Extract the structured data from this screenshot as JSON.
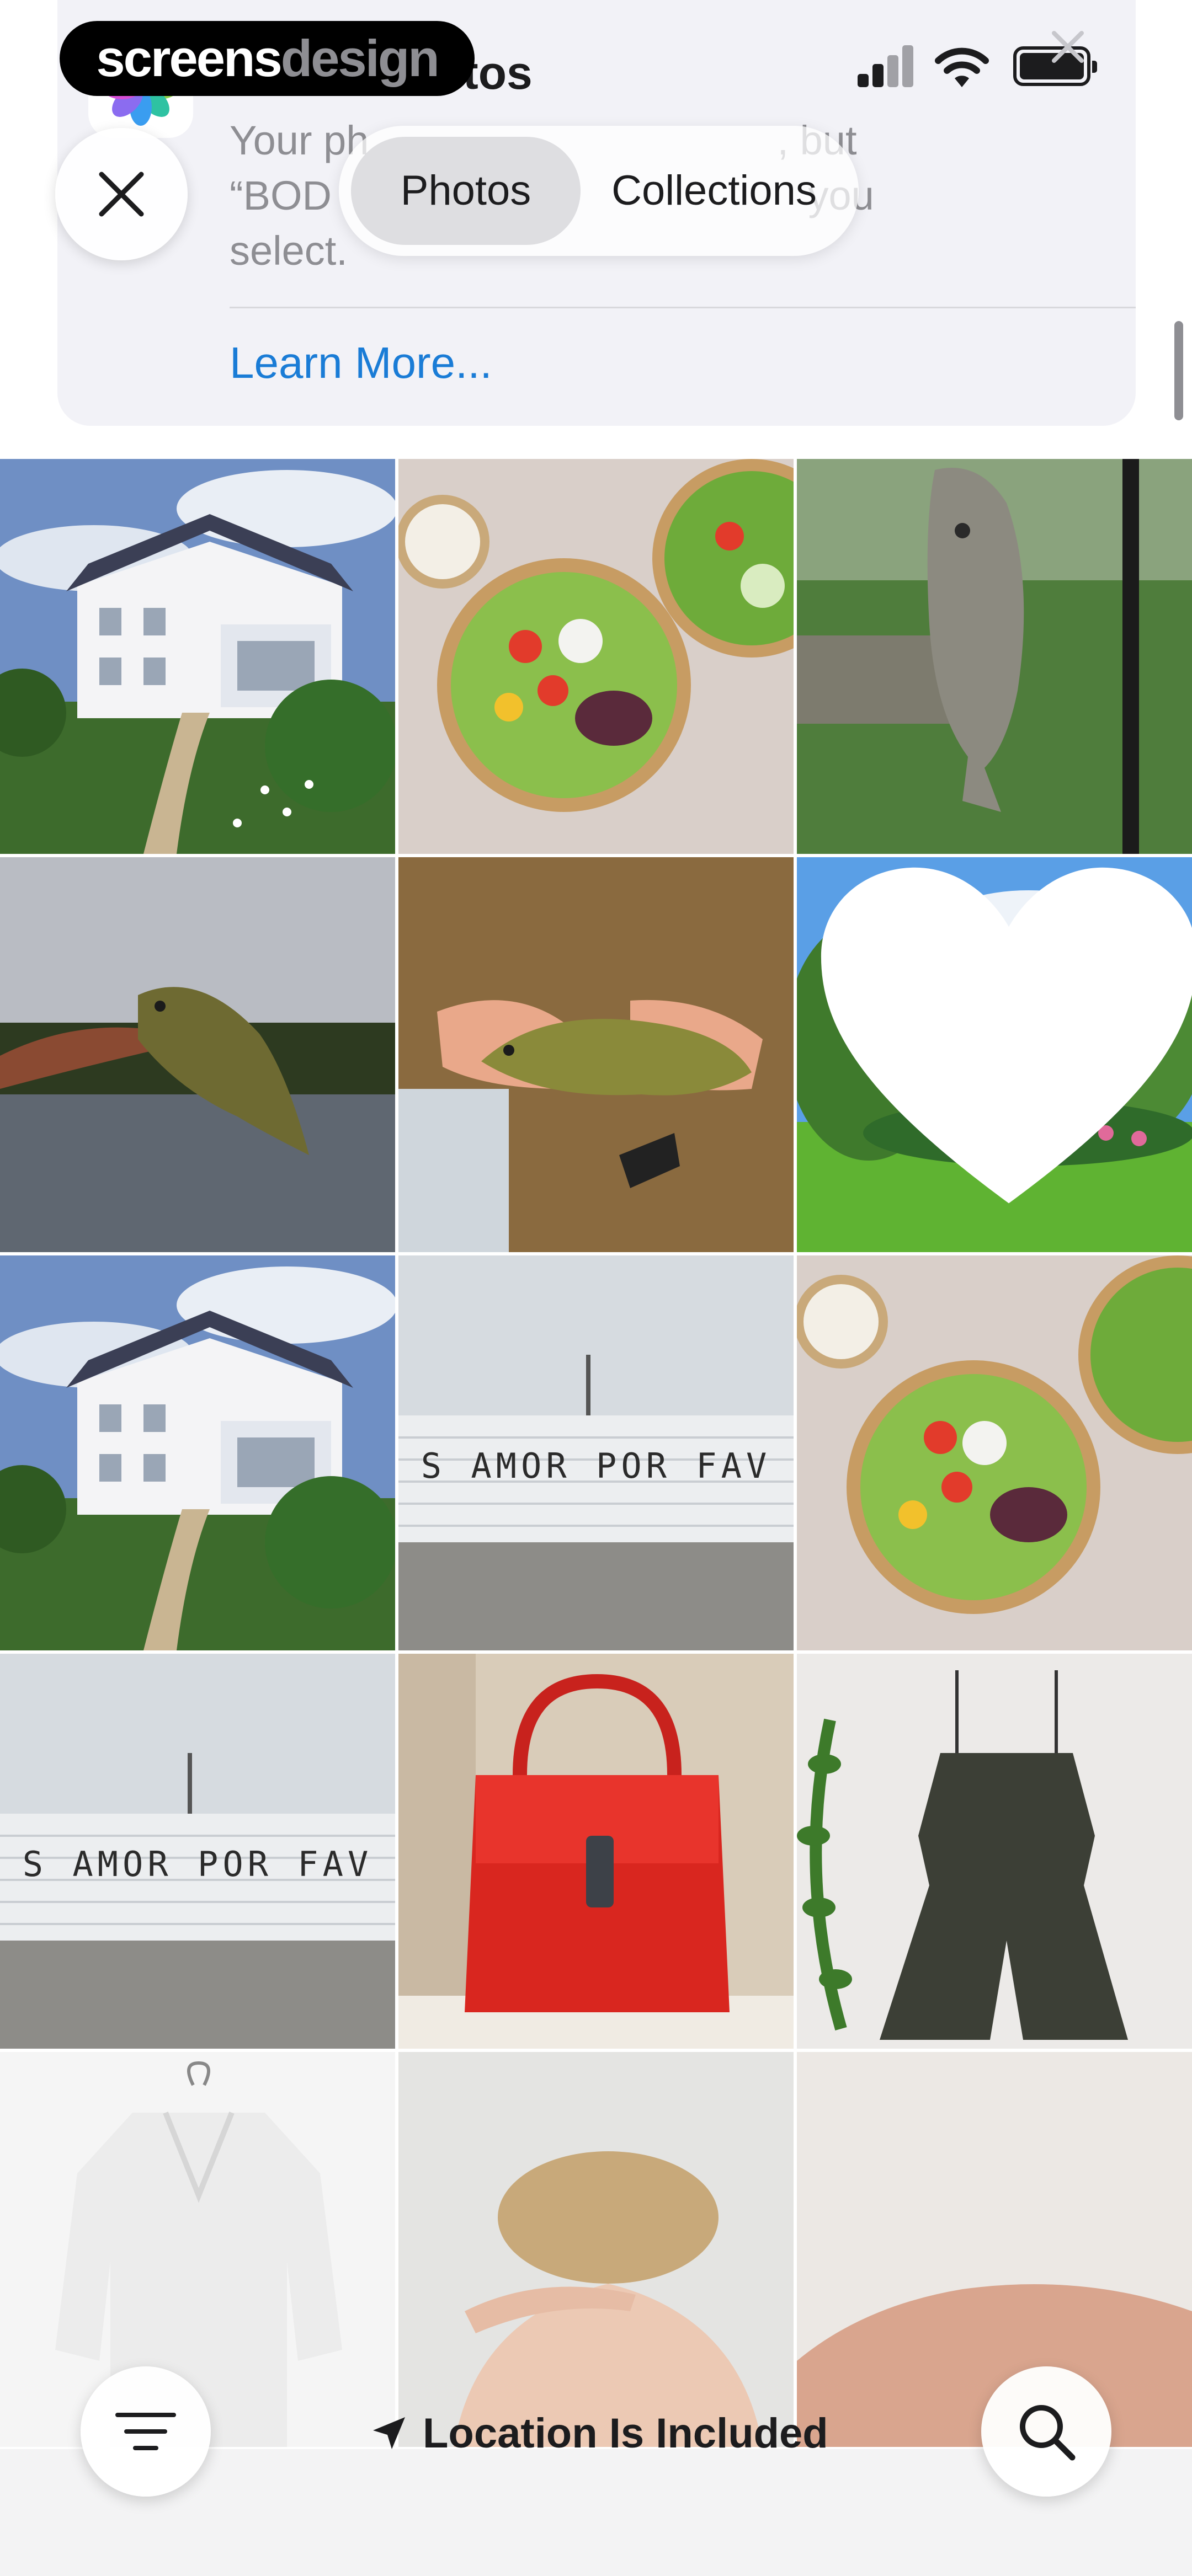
{
  "watermark": {
    "part1": "screens",
    "part2": "design"
  },
  "banner": {
    "title": "ess to Photos",
    "body": "Your ph                                    , but\n“BOD                                          you\nselect.",
    "link": "Learn More..."
  },
  "tabs": [
    {
      "label": "Photos",
      "active": true
    },
    {
      "label": "Collections",
      "active": false
    }
  ],
  "photos": [
    {
      "subject": "house"
    },
    {
      "subject": "salad-bowls"
    },
    {
      "subject": "fish-hanging"
    },
    {
      "subject": "fish-in-hand"
    },
    {
      "subject": "fish-hands"
    },
    {
      "subject": "garden",
      "favorite": true
    },
    {
      "subject": "house"
    },
    {
      "subject": "graffiti-wall",
      "text": "S AMOR POR FAV"
    },
    {
      "subject": "salad-bowl"
    },
    {
      "subject": "graffiti-wall",
      "text": "S AMOR POR FAV"
    },
    {
      "subject": "red-handbag"
    },
    {
      "subject": "romper"
    },
    {
      "subject": "white-jacket"
    },
    {
      "subject": "back-portrait"
    },
    {
      "subject": "shoulder"
    }
  ],
  "bottom": {
    "location_label": "Location Is Included"
  },
  "icons": {
    "close": "close-icon",
    "filter": "filter-icon",
    "search": "search-icon",
    "location": "location-arrow-icon",
    "favorite": "heart-icon",
    "photos_app": "photos-app-icon"
  },
  "colors": {
    "link": "#1a7cd6",
    "background": "#ffffff",
    "banner": "#f2f2f7"
  }
}
